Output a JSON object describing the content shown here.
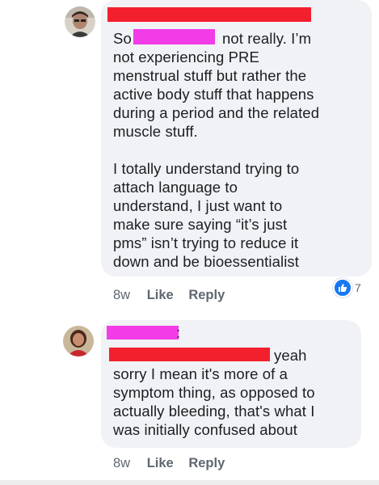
{
  "colors": {
    "redact_red": "#f21f2c",
    "redact_pink": "#f23ce8",
    "bubble_bg": "#f0f2f5",
    "like_blue": "#1877f2"
  },
  "comments": [
    {
      "avatar_icon": "user-avatar-icon",
      "text_prefix": "So",
      "text_line1_rest": "not really. I’m",
      "text_rest": "not experiencing PRE\nmenstrual stuff but rather the\nactive body stuff that happens\nduring a period and the related\nmuscle stuff.\n\nI totally understand trying to\nattach language to\nunderstand, I just want to\nmake sure saying “it’s just\npms” isn’t trying to reduce it\ndown and be bioessentialist",
      "time": "8w",
      "like_label": "Like",
      "reply_label": "Reply",
      "reaction_icon": "thumbs-up-icon",
      "reaction_count": "7"
    },
    {
      "avatar_icon": "user-avatar-icon",
      "name_suffix": ":",
      "text_line1_rest": "yeah",
      "text_rest": "sorry I mean it's more of a\nsymptom thing, as opposed to\nactually bleeding, that's what I\nwas initially confused about",
      "time": "8w",
      "like_label": "Like",
      "reply_label": "Reply"
    }
  ]
}
